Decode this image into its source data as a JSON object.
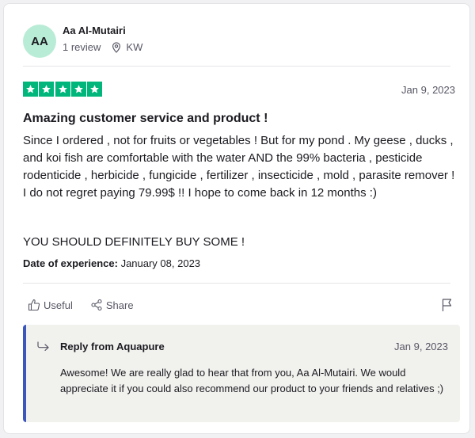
{
  "reviewer": {
    "initials": "AA",
    "name": "Aa Al-Mutairi",
    "review_count": "1 review",
    "country": "KW",
    "location_icon": "location-pin-icon"
  },
  "review": {
    "rating": 5,
    "rating_color": "#00b67a",
    "date": "Jan 9, 2023",
    "title": "Amazing customer service and product !",
    "body": "Since I ordered , not for fruits or vegetables ! But for my pond . My geese , ducks , and koi fish are comfortable with the water AND the 99% bacteria , pesticide rodenticide , herbicide , fungicide , fertilizer , insecticide , mold , parasite remover ! I do not regret paying 79.99$ !! I hope to come back in 12 months :)",
    "shout": "YOU SHOULD DEFINITELY BUY SOME !",
    "experience_label": "Date of experience:",
    "experience_date": "January 08, 2023"
  },
  "actions": {
    "useful_label": "Useful",
    "share_label": "Share"
  },
  "reply": {
    "title": "Reply from Aquapure",
    "date": "Jan 9, 2023",
    "text": "Awesome! We are really glad to hear that from you, Aa Al-Mutairi. We would appreciate it if you could also recommend our product to your friends and relatives ;)",
    "accent_color": "#3c57bc"
  }
}
